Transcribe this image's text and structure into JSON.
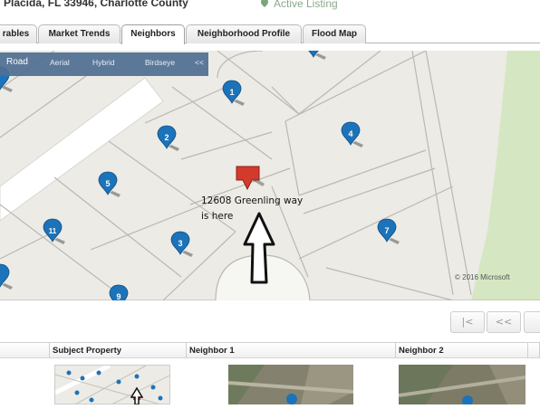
{
  "header": {
    "address": "Placida, FL 33946, Charlotte County",
    "listing_status": "Active Listing"
  },
  "tabs": [
    {
      "label": "rables",
      "active": false
    },
    {
      "label": "Market Trends",
      "active": false
    },
    {
      "label": "Neighbors",
      "active": true
    },
    {
      "label": "Neighborhood Profile",
      "active": false
    },
    {
      "label": "Flood Map",
      "active": false
    }
  ],
  "map": {
    "toolbar": {
      "road": "Road",
      "aerial": "Aerial",
      "hybrid": "Hybrid",
      "birdseye": "Birdseye",
      "collapse": "<<"
    },
    "markers": [
      "1",
      "2",
      "3",
      "4",
      "5",
      "7",
      "9",
      "11"
    ],
    "annotation_line1": "12608 Greenling way",
    "annotation_line2": "is here",
    "copyright": "© 2016 Microsoft",
    "colors": {
      "land": "#ecebe6",
      "road": "#ffffff",
      "parcel_line": "#b9b8b3",
      "green_area": "#d5e7c2",
      "marker": "#1c73b9",
      "subject_marker": "#d33a2c"
    }
  },
  "pager": {
    "first": "|<",
    "prev": "<<"
  },
  "grid": {
    "columns": [
      "Subject Property",
      "Neighbor 1",
      "Neighbor 2"
    ]
  }
}
